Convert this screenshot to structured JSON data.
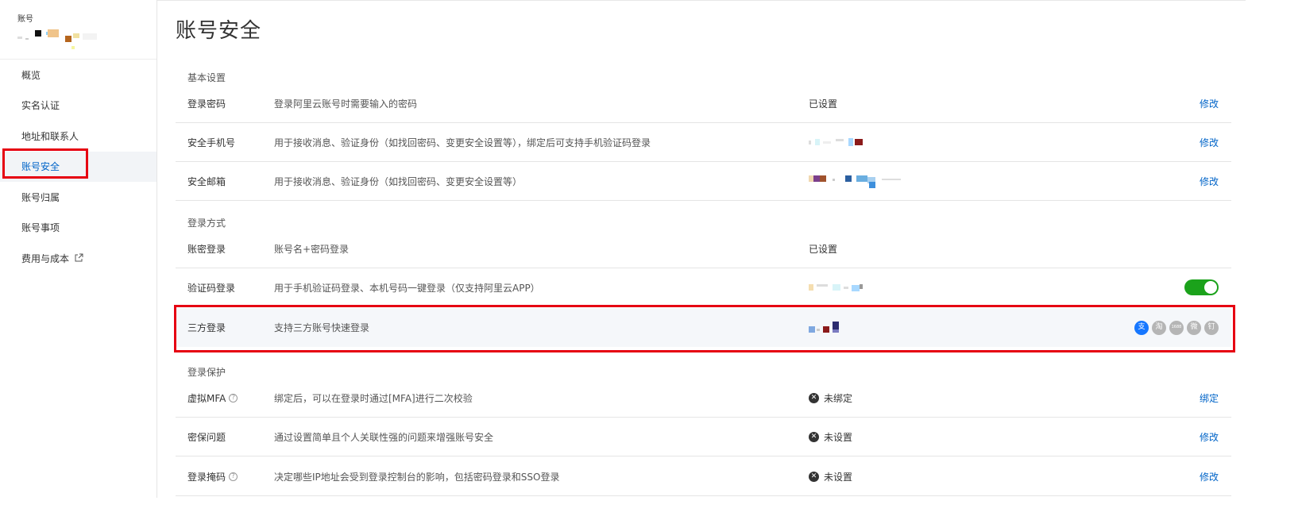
{
  "sidebar": {
    "account_label": "账号",
    "items": [
      {
        "label": "概览"
      },
      {
        "label": "实名认证"
      },
      {
        "label": "地址和联系人"
      },
      {
        "label": "账号安全"
      },
      {
        "label": "账号归属"
      },
      {
        "label": "账号事项"
      },
      {
        "label": "费用与成本"
      }
    ]
  },
  "page": {
    "title": "账号安全"
  },
  "sections": {
    "basic": "基本设置",
    "login_method": "登录方式",
    "login_protect": "登录保护"
  },
  "rows": {
    "password": {
      "name": "登录密码",
      "desc": "登录阿里云账号时需要输入的密码",
      "value": "已设置",
      "action": "修改"
    },
    "phone": {
      "name": "安全手机号",
      "desc": "用于接收消息、验证身份（如找回密码、变更安全设置等），绑定后可支持手机验证码登录",
      "action": "修改"
    },
    "email": {
      "name": "安全邮箱",
      "desc": "用于接收消息、验证身份（如找回密码、变更安全设置等）",
      "action": "修改"
    },
    "pwd_login": {
      "name": "账密登录",
      "desc": "账号名+密码登录",
      "value": "已设置"
    },
    "code_login": {
      "name": "验证码登录",
      "desc": "用于手机验证码登录、本机号码一键登录（仅支持阿里云APP）",
      "toggle_on": true
    },
    "third_login": {
      "name": "三方登录",
      "desc": "支持三方账号快速登录",
      "icons": [
        "alipay-icon",
        "taobao-icon",
        "1688-icon",
        "weibo-icon",
        "dingtalk-icon"
      ],
      "icon_glyphs": [
        "支",
        "淘",
        "1688",
        "微",
        "钉"
      ]
    },
    "mfa": {
      "name": "虚拟MFA",
      "desc": "绑定后，可以在登录时通过[MFA]进行二次校验",
      "value": "未绑定",
      "action": "绑定"
    },
    "security_q": {
      "name": "密保问题",
      "desc": "通过设置简单且个人关联性强的问题来增强账号安全",
      "value": "未设置",
      "action": "修改"
    },
    "login_mask": {
      "name": "登录掩码",
      "desc": "决定哪些IP地址会受到登录控制台的影响，包括密码登录和SSO登录",
      "value": "未设置",
      "action": "修改"
    }
  },
  "colors": {
    "accent": "#0064c8",
    "highlight": "#e60012",
    "toggle": "#1ba21b"
  }
}
